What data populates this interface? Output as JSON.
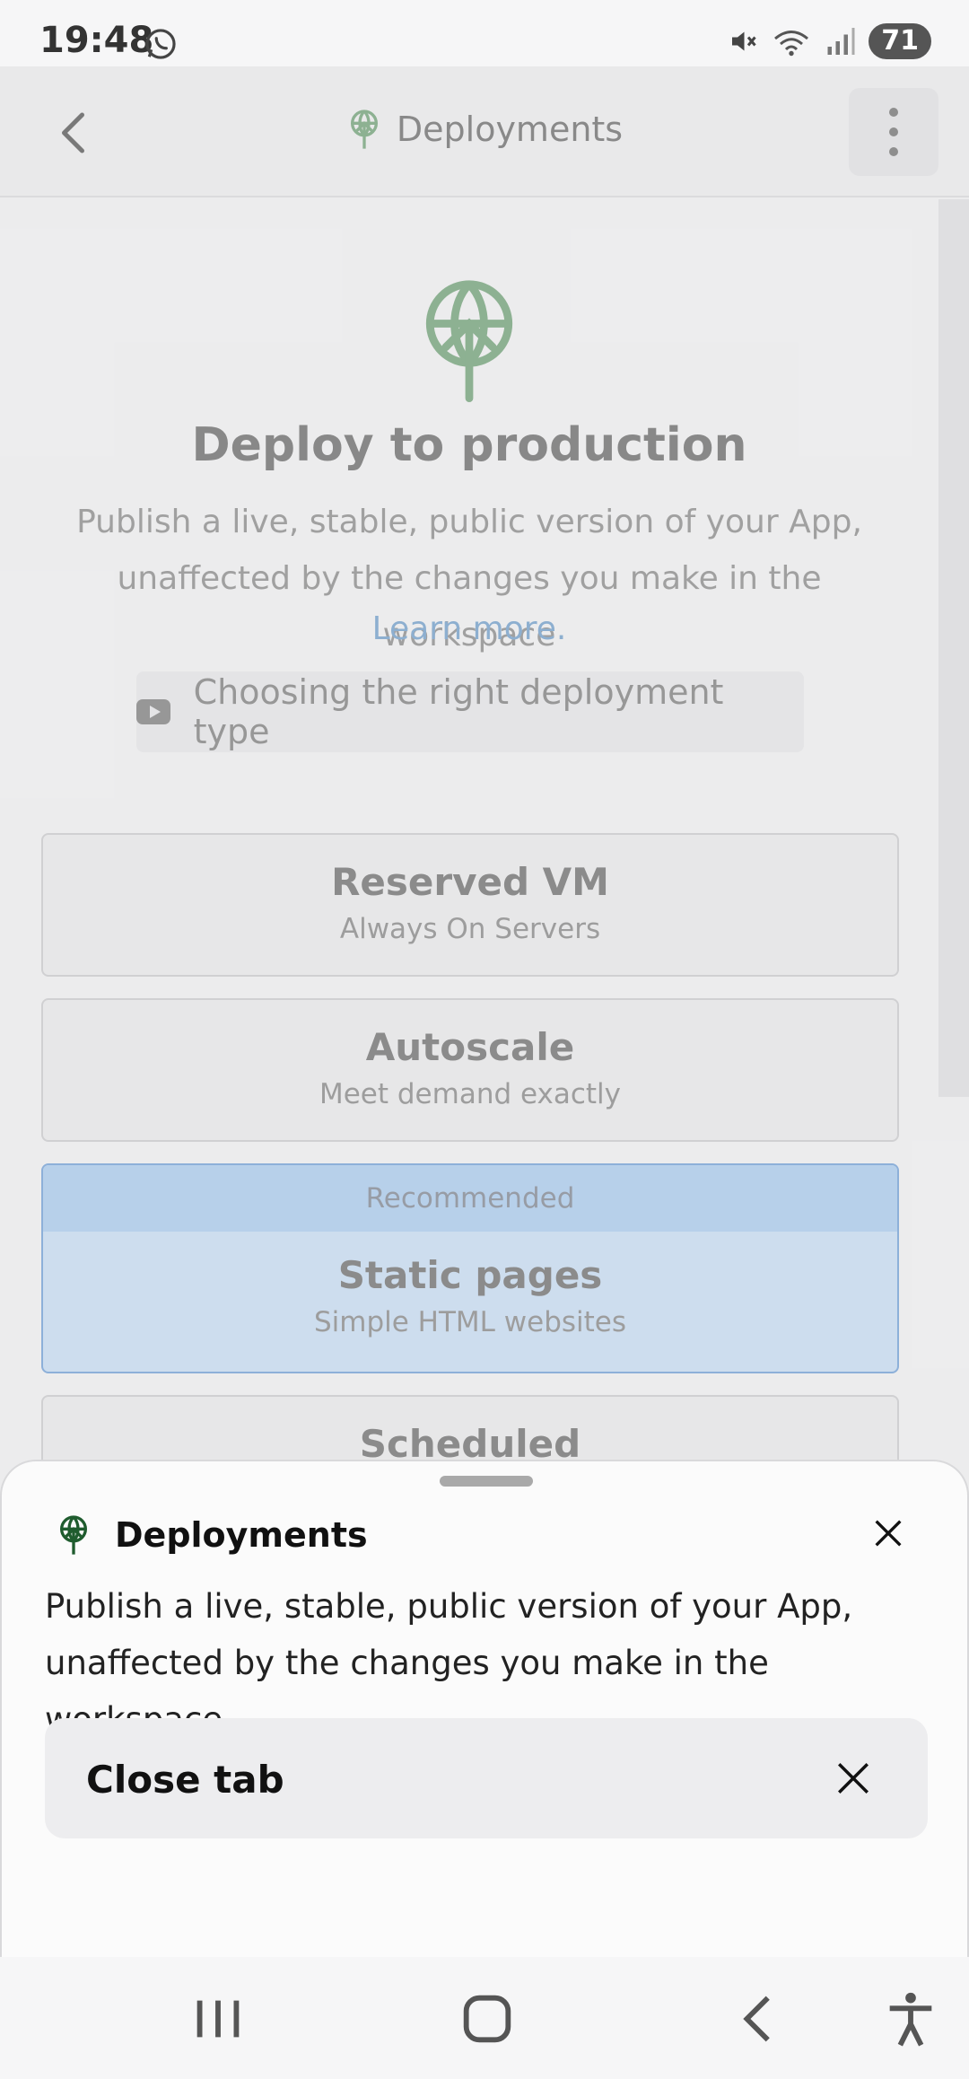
{
  "status_bar": {
    "time": "19:48",
    "battery": "71",
    "icons": [
      "whatsapp-icon",
      "mute-icon",
      "wifi-icon",
      "signal-icon"
    ]
  },
  "header": {
    "title": "Deployments",
    "icons": [
      "back-arrow-icon",
      "deploy-icon",
      "more-vertical-icon"
    ]
  },
  "hero": {
    "title": "Deploy to production",
    "description": "Publish a live, stable, public version of your App, unaffected by the changes you make in the workspace",
    "learn_more": "Learn more.",
    "video_button": "Choosing the right deployment type"
  },
  "deployment_types": [
    {
      "title": "Reserved VM",
      "subtitle": "Always On Servers"
    },
    {
      "title": "Autoscale",
      "subtitle": "Meet demand exactly"
    },
    {
      "badge": "Recommended",
      "title": "Static pages",
      "subtitle": "Simple HTML websites"
    },
    {
      "title": "Scheduled"
    }
  ],
  "sheet": {
    "title": "Deployments",
    "description": "Publish a live, stable, public version of your App, unaffected by the changes you make in the workspace.",
    "close_tab": "Close tab"
  },
  "colors": {
    "accent_green": "#8fb594",
    "selected_blue": "#d3e4f6",
    "link_blue": "#8fb3d6"
  }
}
